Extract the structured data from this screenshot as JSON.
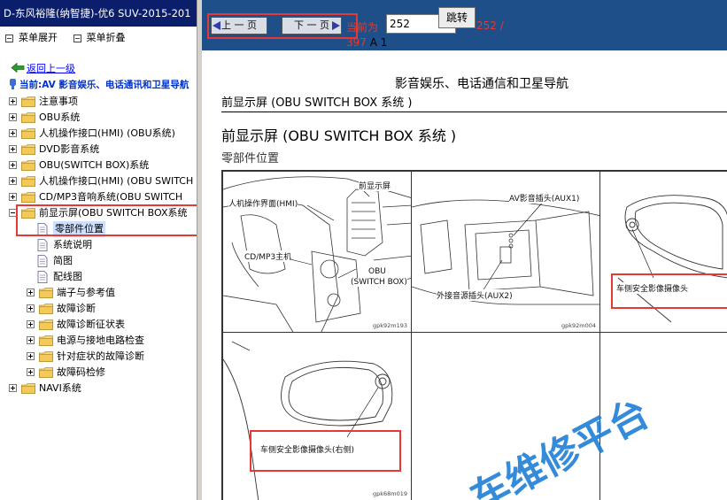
{
  "window": {
    "title": "D-东风裕隆(纳智捷)-优6 SUV-2015-201"
  },
  "toolbar": {
    "expand_label": "菜单展开",
    "collapse_label": "菜单折叠"
  },
  "nav_left": {
    "back_label": "返回上一级",
    "current_label": "当前:AV 影音娱乐、电话通讯和卫星导航"
  },
  "tree": {
    "items": [
      {
        "label": "注意事项"
      },
      {
        "label": "OBU系统"
      },
      {
        "label": "人机操作接口(HMI) (OBU系统)"
      },
      {
        "label": "DVD影音系统"
      },
      {
        "label": "OBU(SWITCH BOX)系统"
      },
      {
        "label": "人机操作接口(HMI) (OBU SWITCH"
      },
      {
        "label": "CD/MP3音响系统(OBU SWITCH"
      },
      {
        "label": "前显示屏(OBU SWITCH BOX系统"
      },
      {
        "label": "零部件位置"
      },
      {
        "label": "系统说明"
      },
      {
        "label": "简图"
      },
      {
        "label": "配线图"
      },
      {
        "label": "端子与参考值"
      },
      {
        "label": "故障诊断"
      },
      {
        "label": "故障诊断征状表"
      },
      {
        "label": "电源与接地电路检查"
      },
      {
        "label": "针对症状的故障诊断"
      },
      {
        "label": "故障码检修"
      },
      {
        "label": "NAVI系统"
      }
    ]
  },
  "pager": {
    "prev_label": "上 一 页",
    "next_label": "下 一 页",
    "current_label": "当前为",
    "page_value": "252",
    "jump_label": "跳转",
    "total_part1": "252 /",
    "total_part2": "397",
    "suffix": "A 1"
  },
  "doc": {
    "title": "影音娱乐、电话通信和卫星导航",
    "subtitle": "前显示屏 (OBU SWITCH BOX 系统 )",
    "heading": "前显示屏 (OBU SWITCH BOX 系统 )",
    "section": "零部件位置",
    "figures": {
      "fig1_labels": [
        "前显示屏",
        "人机操作界面(HMI)",
        "CD/MP3主机",
        "OBU",
        "(SWITCH BOX)"
      ],
      "fig1_code": "gpk92m193",
      "fig2_labels": [
        "AV影音插头(AUX1)",
        "外接音源插头(AUX2)"
      ],
      "fig2_code": "gpk92m004",
      "fig3_label": "车侧安全影像摄像头",
      "fig4_label": "车侧安全影像摄像头(右侧)",
      "fig4_code": "gpk68m019"
    },
    "watermark": "车维修平台"
  },
  "colors": {
    "title_bar": "#0b1e6b",
    "nav_bar": "#1f4f88",
    "highlight": "#e53935",
    "link": "#0000ff"
  }
}
